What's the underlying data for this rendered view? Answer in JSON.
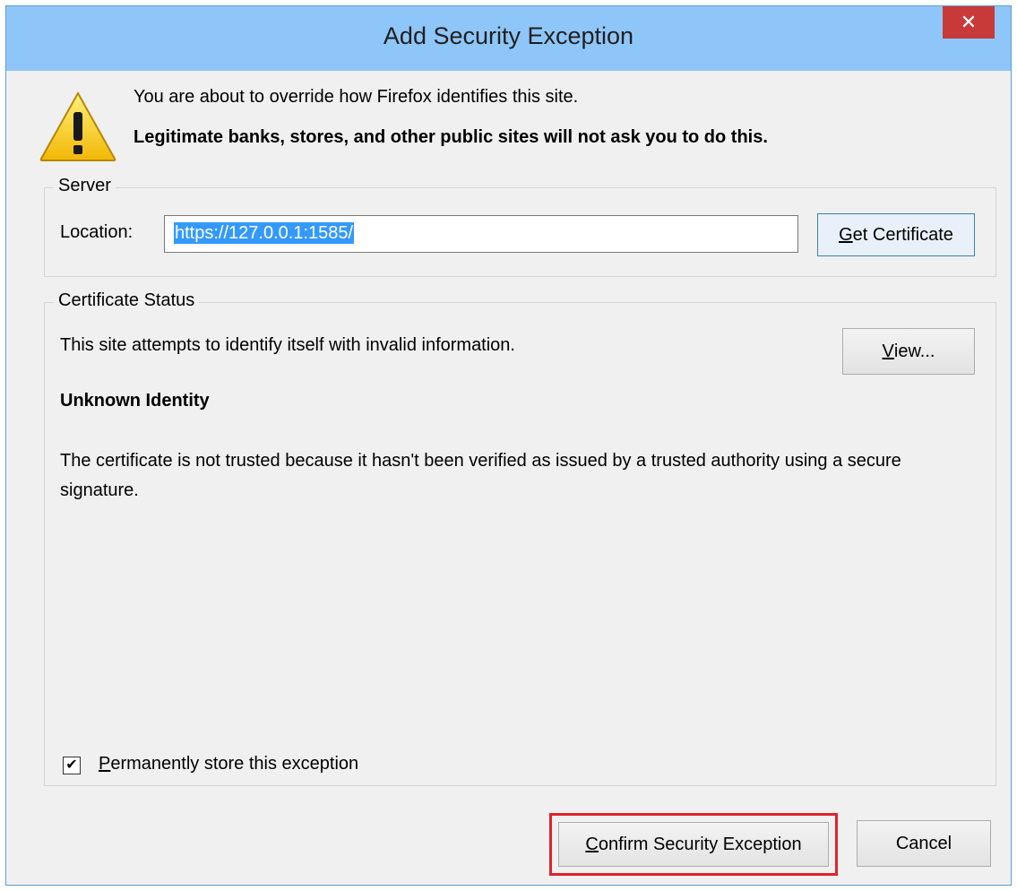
{
  "window": {
    "title": "Add Security Exception",
    "close_symbol": "✕"
  },
  "warning": {
    "line1": "You are about to override how Firefox identifies this site.",
    "line2": "Legitimate banks, stores, and other public sites will not ask you to do this."
  },
  "server": {
    "legend": "Server",
    "location_label": "Location:",
    "location_value": "https://127.0.0.1:1585/",
    "get_certificate_accel": "G",
    "get_certificate_rest": "et Certificate"
  },
  "status": {
    "legend": "Certificate Status",
    "line1": "This site attempts to identify itself with invalid information.",
    "view_accel": "V",
    "view_rest": "iew...",
    "heading": "Unknown Identity",
    "description": "The certificate is not trusted because it hasn't been verified as issued by a trusted authority using a secure signature."
  },
  "permanent": {
    "checked": true,
    "check_symbol": "✔",
    "label_accel": "P",
    "label_rest": "ermanently store this exception"
  },
  "buttons": {
    "confirm_accel": "C",
    "confirm_rest": "onfirm Security Exception",
    "cancel": "Cancel"
  },
  "colors": {
    "titlebar": "#8fc6f9",
    "close": "#c83a3a",
    "highlight": "#e0232b",
    "selection": "#3399ff"
  }
}
